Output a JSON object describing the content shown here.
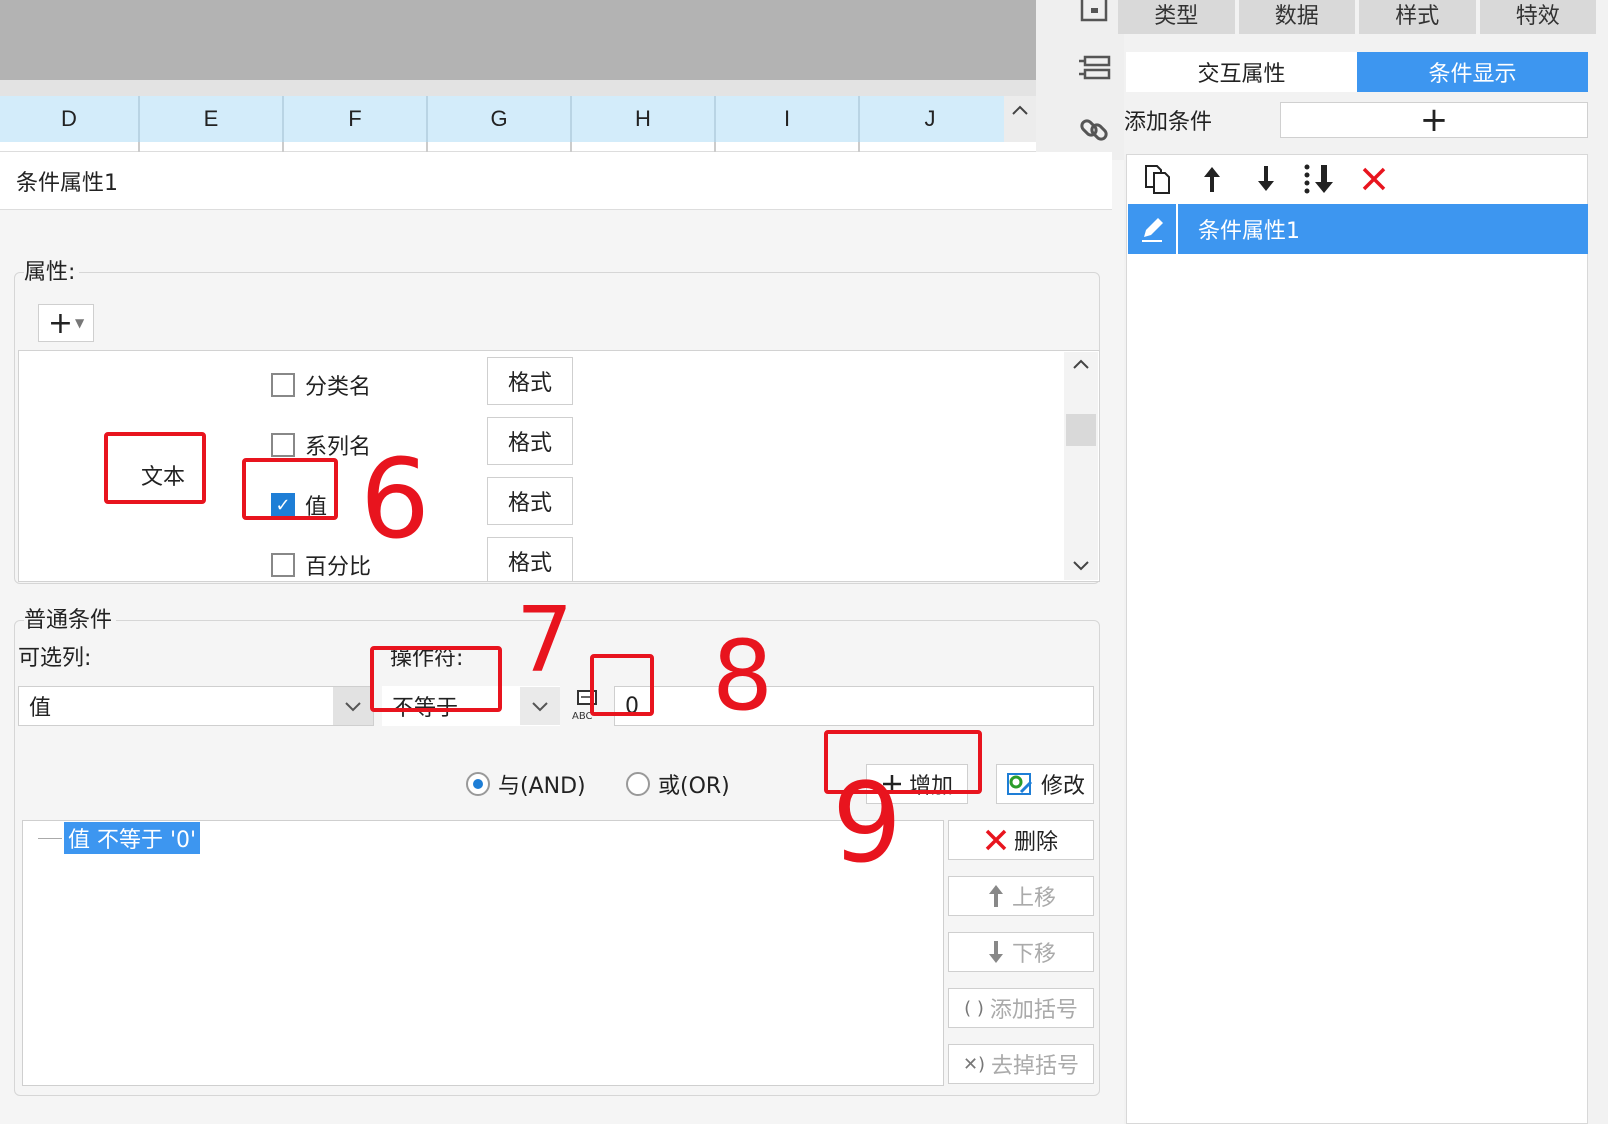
{
  "top_tabs": [
    "类型",
    "数据",
    "样式",
    "特效"
  ],
  "sub_tabs": {
    "interaction": "交互属性",
    "condition_display": "条件显示"
  },
  "columns": [
    "D",
    "E",
    "F",
    "G",
    "H",
    "I",
    "J"
  ],
  "add_condition": {
    "label": "添加条件",
    "button": "+"
  },
  "condition_list": {
    "items": [
      "条件属性1"
    ]
  },
  "panel_title": "条件属性1",
  "attributes": {
    "group_label": "属性:",
    "add_button": "+",
    "text_label": "文本",
    "options": [
      {
        "label": "分类名",
        "checked": false,
        "format": "格式"
      },
      {
        "label": "系列名",
        "checked": false,
        "format": "格式"
      },
      {
        "label": "值",
        "checked": true,
        "format": "格式"
      },
      {
        "label": "百分比",
        "checked": false,
        "format": "格式"
      }
    ]
  },
  "normal_condition": {
    "group_label": "普通条件",
    "column_label": "可选列:",
    "operator_label": "操作符:",
    "column_value": "值",
    "operator_value": "不等于",
    "value": "0",
    "logic": {
      "and": "与(AND)",
      "or": "或(OR)",
      "selected": "and"
    },
    "buttons": {
      "add": "增加",
      "modify": "修改",
      "delete": "删除",
      "up": "上移",
      "down": "下移",
      "add_bracket": "添加括号",
      "remove_bracket": "去掉括号"
    },
    "tree_item": "值 不等于 '0'"
  },
  "annotations": {
    "n6": "6",
    "n7": "7",
    "n8": "8",
    "n9": "9"
  },
  "colors": {
    "accent": "#3d96f0",
    "annotation": "#e8141e",
    "header": "#d3ecfa"
  }
}
